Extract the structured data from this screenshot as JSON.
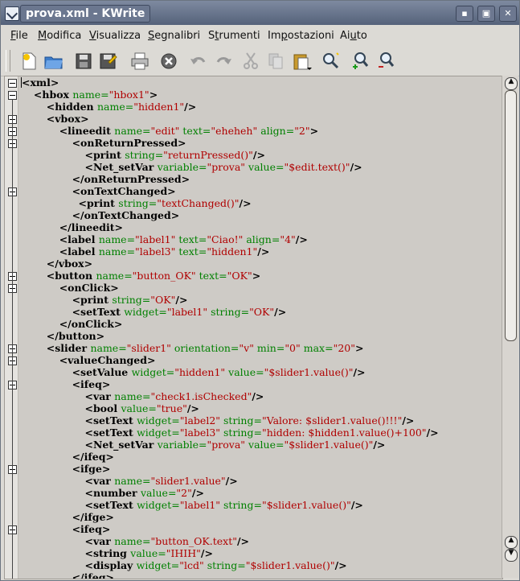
{
  "window": {
    "title": "prova.xml - KWrite"
  },
  "menubar": {
    "items": [
      {
        "label": "File",
        "mnemonic": "F"
      },
      {
        "label": "Modifica",
        "mnemonic": "M"
      },
      {
        "label": "Visualizza",
        "mnemonic": "V"
      },
      {
        "label": "Segnalibri",
        "mnemonic": "S"
      },
      {
        "label": "Strumenti",
        "mnemonic": "t"
      },
      {
        "label": "Impostazioni",
        "mnemonic": "p"
      },
      {
        "label": "Aiuto",
        "mnemonic": "u"
      }
    ]
  },
  "toolbar": {
    "buttons": [
      "new-file-icon",
      "open-folder-icon",
      "save-icon",
      "save-as-icon",
      "print-icon",
      "close-document-icon",
      "undo-icon",
      "redo-icon",
      "cut-icon",
      "copy-icon",
      "paste-icon",
      "find-icon",
      "zoom-in-icon",
      "zoom-out-icon"
    ]
  },
  "editor": {
    "lines": [
      [
        {
          "t": "tag",
          "v": "<xml>"
        }
      ],
      [
        {
          "t": "i",
          "v": "    "
        },
        {
          "t": "tag",
          "v": "<hbox "
        },
        {
          "t": "attr",
          "v": "name="
        },
        {
          "t": "val",
          "v": "\"hbox1\""
        },
        {
          "t": "tag",
          "v": ">"
        }
      ],
      [
        {
          "t": "i",
          "v": "        "
        },
        {
          "t": "tag",
          "v": "<hidden "
        },
        {
          "t": "attr",
          "v": "name="
        },
        {
          "t": "val",
          "v": "\"hidden1\""
        },
        {
          "t": "tag",
          "v": "/>"
        }
      ],
      [
        {
          "t": "i",
          "v": "        "
        },
        {
          "t": "tag",
          "v": "<vbox>"
        }
      ],
      [
        {
          "t": "i",
          "v": "            "
        },
        {
          "t": "tag",
          "v": "<lineedit "
        },
        {
          "t": "attr",
          "v": "name="
        },
        {
          "t": "val",
          "v": "\"edit\""
        },
        {
          "t": "attr",
          "v": " text="
        },
        {
          "t": "val",
          "v": "\"eheheh\""
        },
        {
          "t": "attr",
          "v": " align="
        },
        {
          "t": "val",
          "v": "\"2\""
        },
        {
          "t": "tag",
          "v": ">"
        }
      ],
      [
        {
          "t": "i",
          "v": "                "
        },
        {
          "t": "tag",
          "v": "<onReturnPressed>"
        }
      ],
      [
        {
          "t": "i",
          "v": "                    "
        },
        {
          "t": "tag",
          "v": "<print "
        },
        {
          "t": "attr",
          "v": "string="
        },
        {
          "t": "val",
          "v": "\"returnPressed()\""
        },
        {
          "t": "tag",
          "v": "/>"
        }
      ],
      [
        {
          "t": "i",
          "v": "                    "
        },
        {
          "t": "tag",
          "v": "<Net_setVar "
        },
        {
          "t": "attr",
          "v": "variable="
        },
        {
          "t": "val",
          "v": "\"prova\""
        },
        {
          "t": "attr",
          "v": " value="
        },
        {
          "t": "val",
          "v": "\"$edit.text()\""
        },
        {
          "t": "tag",
          "v": "/>"
        }
      ],
      [
        {
          "t": "i",
          "v": "                "
        },
        {
          "t": "tag",
          "v": "</onReturnPressed>"
        }
      ],
      [
        {
          "t": "i",
          "v": "                "
        },
        {
          "t": "tag",
          "v": "<onTextChanged>"
        }
      ],
      [
        {
          "t": "i",
          "v": "                  "
        },
        {
          "t": "tag",
          "v": "<print "
        },
        {
          "t": "attr",
          "v": "string="
        },
        {
          "t": "val",
          "v": "\"textChanged()\""
        },
        {
          "t": "tag",
          "v": "/>"
        }
      ],
      [
        {
          "t": "i",
          "v": "                "
        },
        {
          "t": "tag",
          "v": "</onTextChanged>"
        }
      ],
      [
        {
          "t": "i",
          "v": "            "
        },
        {
          "t": "tag",
          "v": "</lineedit>"
        }
      ],
      [
        {
          "t": "i",
          "v": "            "
        },
        {
          "t": "tag",
          "v": "<label "
        },
        {
          "t": "attr",
          "v": "name="
        },
        {
          "t": "val",
          "v": "\"label1\""
        },
        {
          "t": "attr",
          "v": " text="
        },
        {
          "t": "val",
          "v": "\"Ciao!\""
        },
        {
          "t": "attr",
          "v": " align="
        },
        {
          "t": "val",
          "v": "\"4\""
        },
        {
          "t": "tag",
          "v": "/>"
        }
      ],
      [
        {
          "t": "i",
          "v": "            "
        },
        {
          "t": "tag",
          "v": "<label "
        },
        {
          "t": "attr",
          "v": "name="
        },
        {
          "t": "val",
          "v": "\"label3\""
        },
        {
          "t": "attr",
          "v": " text="
        },
        {
          "t": "val",
          "v": "\"hidden1\""
        },
        {
          "t": "tag",
          "v": "/>"
        }
      ],
      [
        {
          "t": "i",
          "v": "        "
        },
        {
          "t": "tag",
          "v": "</vbox>"
        }
      ],
      [
        {
          "t": "i",
          "v": "        "
        },
        {
          "t": "tag",
          "v": "<button "
        },
        {
          "t": "attr",
          "v": "name="
        },
        {
          "t": "val",
          "v": "\"button_OK\""
        },
        {
          "t": "attr",
          "v": " text="
        },
        {
          "t": "val",
          "v": "\"OK\""
        },
        {
          "t": "tag",
          "v": ">"
        }
      ],
      [
        {
          "t": "i",
          "v": "            "
        },
        {
          "t": "tag",
          "v": "<onClick>"
        }
      ],
      [
        {
          "t": "i",
          "v": "                "
        },
        {
          "t": "tag",
          "v": "<print "
        },
        {
          "t": "attr",
          "v": "string="
        },
        {
          "t": "val",
          "v": "\"OK\""
        },
        {
          "t": "tag",
          "v": "/>"
        }
      ],
      [
        {
          "t": "i",
          "v": "                "
        },
        {
          "t": "tag",
          "v": "<setText "
        },
        {
          "t": "attr",
          "v": "widget="
        },
        {
          "t": "val",
          "v": "\"label1\""
        },
        {
          "t": "attr",
          "v": " string="
        },
        {
          "t": "val",
          "v": "\"OK\""
        },
        {
          "t": "tag",
          "v": "/>"
        }
      ],
      [
        {
          "t": "i",
          "v": "            "
        },
        {
          "t": "tag",
          "v": "</onClick>"
        }
      ],
      [
        {
          "t": "i",
          "v": "        "
        },
        {
          "t": "tag",
          "v": "</button>"
        }
      ],
      [
        {
          "t": "i",
          "v": "        "
        },
        {
          "t": "tag",
          "v": "<slider "
        },
        {
          "t": "attr",
          "v": "name="
        },
        {
          "t": "val",
          "v": "\"slider1\""
        },
        {
          "t": "attr",
          "v": " orientation="
        },
        {
          "t": "val",
          "v": "\"v\""
        },
        {
          "t": "attr",
          "v": " min="
        },
        {
          "t": "val",
          "v": "\"0\""
        },
        {
          "t": "attr",
          "v": " max="
        },
        {
          "t": "val",
          "v": "\"20\""
        },
        {
          "t": "tag",
          "v": ">"
        }
      ],
      [
        {
          "t": "i",
          "v": "            "
        },
        {
          "t": "tag",
          "v": "<valueChanged>"
        }
      ],
      [
        {
          "t": "i",
          "v": "                "
        },
        {
          "t": "tag",
          "v": "<setValue "
        },
        {
          "t": "attr",
          "v": "widget="
        },
        {
          "t": "val",
          "v": "\"hidden1\""
        },
        {
          "t": "attr",
          "v": " value="
        },
        {
          "t": "val",
          "v": "\"$slider1.value()\""
        },
        {
          "t": "tag",
          "v": "/>"
        }
      ],
      [
        {
          "t": "i",
          "v": "                "
        },
        {
          "t": "tag",
          "v": "<ifeq>"
        }
      ],
      [
        {
          "t": "i",
          "v": "                    "
        },
        {
          "t": "tag",
          "v": "<var "
        },
        {
          "t": "attr",
          "v": "name="
        },
        {
          "t": "val",
          "v": "\"check1.isChecked\""
        },
        {
          "t": "tag",
          "v": "/>"
        }
      ],
      [
        {
          "t": "i",
          "v": "                    "
        },
        {
          "t": "tag",
          "v": "<bool "
        },
        {
          "t": "attr",
          "v": "value="
        },
        {
          "t": "val",
          "v": "\"true\""
        },
        {
          "t": "tag",
          "v": "/>"
        }
      ],
      [
        {
          "t": "i",
          "v": "                    "
        },
        {
          "t": "tag",
          "v": "<setText "
        },
        {
          "t": "attr",
          "v": "widget="
        },
        {
          "t": "val",
          "v": "\"label2\""
        },
        {
          "t": "attr",
          "v": " string="
        },
        {
          "t": "val",
          "v": "\"Valore: $slider1.value()!!!\""
        },
        {
          "t": "tag",
          "v": "/>"
        }
      ],
      [
        {
          "t": "i",
          "v": "                    "
        },
        {
          "t": "tag",
          "v": "<setText "
        },
        {
          "t": "attr",
          "v": "widget="
        },
        {
          "t": "val",
          "v": "\"label3\""
        },
        {
          "t": "attr",
          "v": " string="
        },
        {
          "t": "val",
          "v": "\"hidden: $hidden1.value()+100\""
        },
        {
          "t": "tag",
          "v": "/>"
        }
      ],
      [
        {
          "t": "i",
          "v": "                    "
        },
        {
          "t": "tag",
          "v": "<Net_setVar "
        },
        {
          "t": "attr",
          "v": "variable="
        },
        {
          "t": "val",
          "v": "\"prova\""
        },
        {
          "t": "attr",
          "v": " value="
        },
        {
          "t": "val",
          "v": "\"$slider1.value()\""
        },
        {
          "t": "tag",
          "v": "/>"
        }
      ],
      [
        {
          "t": "i",
          "v": "                "
        },
        {
          "t": "tag",
          "v": "</ifeq>"
        }
      ],
      [
        {
          "t": "i",
          "v": "                "
        },
        {
          "t": "tag",
          "v": "<ifge>"
        }
      ],
      [
        {
          "t": "i",
          "v": "                    "
        },
        {
          "t": "tag",
          "v": "<var "
        },
        {
          "t": "attr",
          "v": "name="
        },
        {
          "t": "val",
          "v": "\"slider1.value\""
        },
        {
          "t": "tag",
          "v": "/>"
        }
      ],
      [
        {
          "t": "i",
          "v": "                    "
        },
        {
          "t": "tag",
          "v": "<number "
        },
        {
          "t": "attr",
          "v": "value="
        },
        {
          "t": "val",
          "v": "\"2\""
        },
        {
          "t": "tag",
          "v": "/>"
        }
      ],
      [
        {
          "t": "i",
          "v": "                    "
        },
        {
          "t": "tag",
          "v": "<setText "
        },
        {
          "t": "attr",
          "v": "widget="
        },
        {
          "t": "val",
          "v": "\"label1\""
        },
        {
          "t": "attr",
          "v": " string="
        },
        {
          "t": "val",
          "v": "\"$slider1.value()\""
        },
        {
          "t": "tag",
          "v": "/>"
        }
      ],
      [
        {
          "t": "i",
          "v": "                "
        },
        {
          "t": "tag",
          "v": "</ifge>"
        }
      ],
      [
        {
          "t": "i",
          "v": "                "
        },
        {
          "t": "tag",
          "v": "<ifeq>"
        }
      ],
      [
        {
          "t": "i",
          "v": "                    "
        },
        {
          "t": "tag",
          "v": "<var "
        },
        {
          "t": "attr",
          "v": "name="
        },
        {
          "t": "val",
          "v": "\"button_OK.text\""
        },
        {
          "t": "tag",
          "v": "/>"
        }
      ],
      [
        {
          "t": "i",
          "v": "                    "
        },
        {
          "t": "tag",
          "v": "<string "
        },
        {
          "t": "attr",
          "v": "value="
        },
        {
          "t": "val",
          "v": "\"IHIH\""
        },
        {
          "t": "tag",
          "v": "/>"
        }
      ],
      [
        {
          "t": "i",
          "v": "                    "
        },
        {
          "t": "tag",
          "v": "<display "
        },
        {
          "t": "attr",
          "v": "widget="
        },
        {
          "t": "val",
          "v": "\"lcd\""
        },
        {
          "t": "attr",
          "v": " string="
        },
        {
          "t": "val",
          "v": "\"$slider1.value()\""
        },
        {
          "t": "tag",
          "v": "/>"
        }
      ],
      [
        {
          "t": "i",
          "v": "                "
        },
        {
          "t": "tag",
          "v": "</ifeq>"
        }
      ]
    ]
  }
}
